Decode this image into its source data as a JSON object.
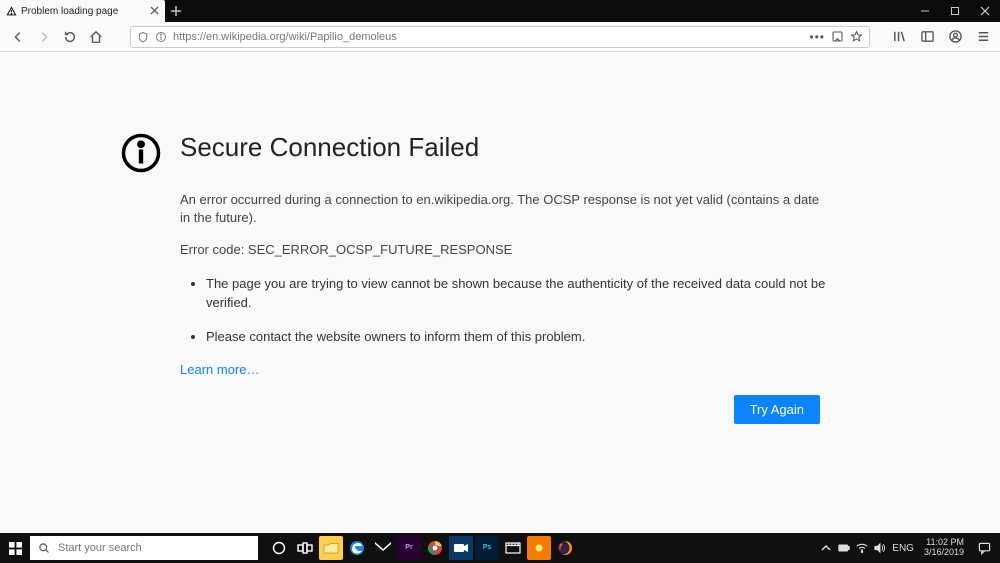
{
  "browser": {
    "tab": {
      "title": "Problem loading page"
    },
    "url": "https://en.wikipedia.org/wiki/Papilio_demoleus"
  },
  "error": {
    "heading": "Secure Connection Failed",
    "message": "An error occurred during a connection to en.wikipedia.org. The OCSP response is not yet valid (contains a date in the future).",
    "code": "Error code: SEC_ERROR_OCSP_FUTURE_RESPONSE",
    "bullets": [
      "The page you are trying to view cannot be shown because the authenticity of the received data could not be verified.",
      "Please contact the website owners to inform them of this problem."
    ],
    "learn_more": "Learn more…",
    "try_again": "Try Again"
  },
  "taskbar": {
    "search_placeholder": "Start your search",
    "language": "ENG",
    "time": "11:02 PM",
    "date": "3/16/2019"
  }
}
